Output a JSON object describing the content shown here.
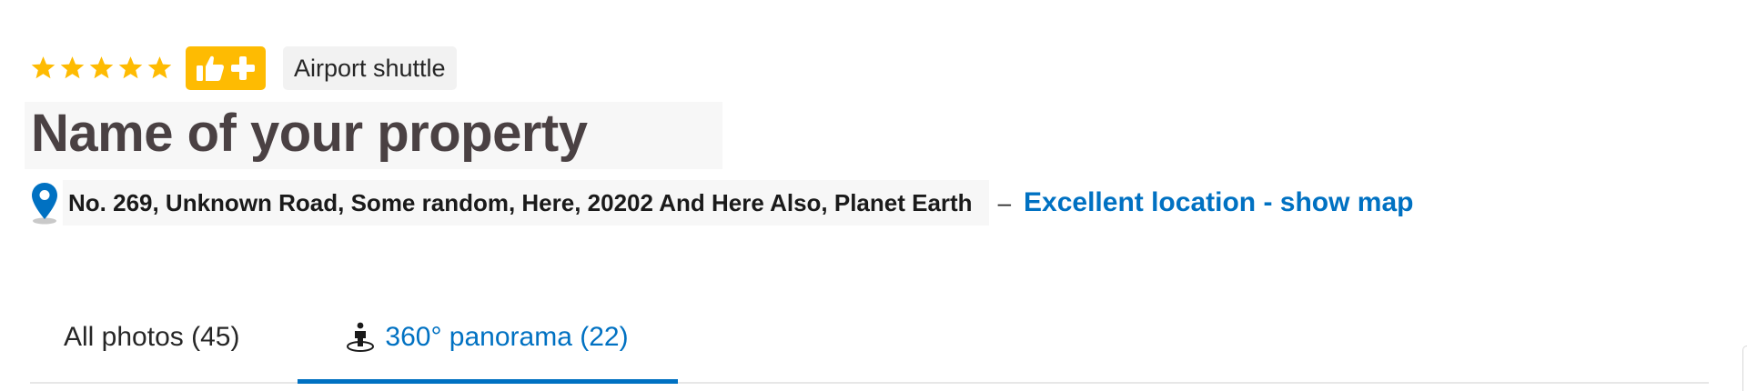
{
  "rating": {
    "stars": 5,
    "star_color": "#febb02",
    "star_icon": "star-icon",
    "badge_icons": [
      "thumbs-up-icon",
      "plus-icon"
    ],
    "badge_color": "#febb02"
  },
  "facility_chip": {
    "label": "Airport shuttle"
  },
  "property": {
    "title": "Name of your property",
    "address": "No. 269, Unknown Road, Some random, Here, 20202 And Here Also, Planet Earth",
    "separator": "–",
    "location_link": "Excellent location - show map",
    "pin_icon": "map-pin-icon",
    "link_color": "#0071c2"
  },
  "tabs": [
    {
      "label": "All photos (45)",
      "active": false
    },
    {
      "label": "360° panorama (22)",
      "active": true,
      "icon": "panorama-person-icon"
    }
  ]
}
